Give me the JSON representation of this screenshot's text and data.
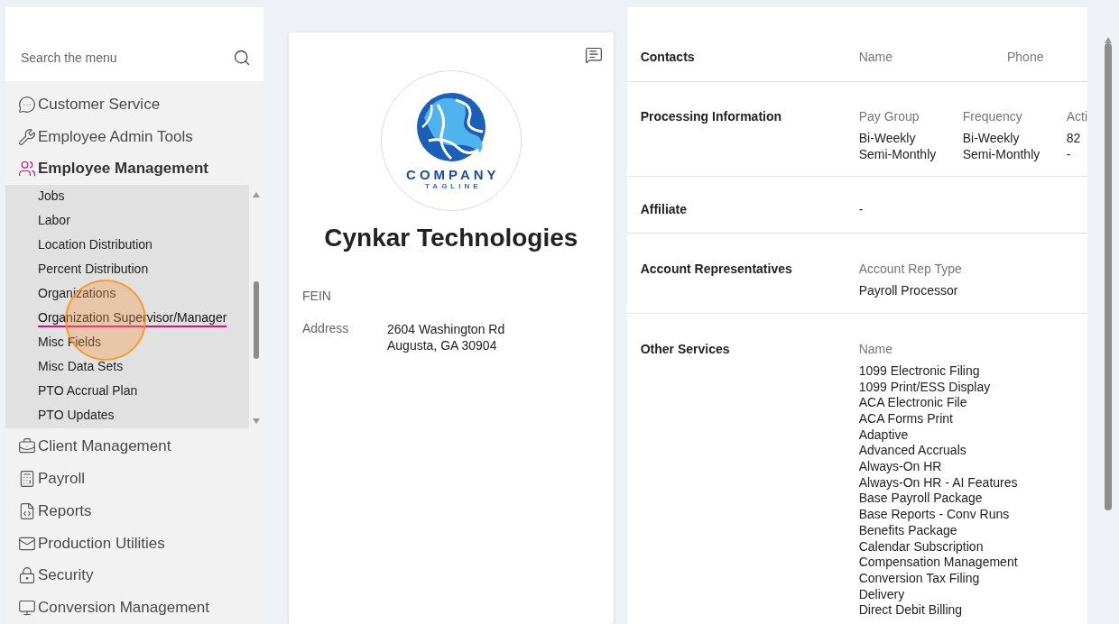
{
  "sidebar": {
    "search": {
      "placeholder": "Search the menu"
    },
    "menu_top": [
      {
        "label": "Customer Service",
        "selected": false
      },
      {
        "label": "Employee Admin Tools",
        "selected": false
      },
      {
        "label": "Employee Management",
        "selected": true
      }
    ],
    "submenu": [
      {
        "label": "Jobs",
        "selected": false
      },
      {
        "label": "Labor",
        "selected": false
      },
      {
        "label": "Location Distribution",
        "selected": false
      },
      {
        "label": "Percent Distribution",
        "selected": false
      },
      {
        "label": "Organizations",
        "selected": false
      },
      {
        "label": "Organization Supervisor/Manager",
        "selected": true
      },
      {
        "label": "Misc Fields",
        "selected": false
      },
      {
        "label": "Misc Data Sets",
        "selected": false
      },
      {
        "label": "PTO Accrual Plan",
        "selected": false
      },
      {
        "label": "PTO Updates",
        "selected": false
      }
    ],
    "menu_bottom": [
      {
        "label": "Client Management",
        "selected": false
      },
      {
        "label": "Payroll",
        "selected": false
      },
      {
        "label": "Reports",
        "selected": false
      },
      {
        "label": "Production Utilities",
        "selected": false
      },
      {
        "label": "Security",
        "selected": false
      },
      {
        "label": "Conversion Management",
        "selected": false
      }
    ]
  },
  "company": {
    "logo": {
      "wordmark": "COMPANY",
      "tagline": "TAGLINE"
    },
    "name": "Cynkar Technologies",
    "fields": [
      {
        "label": "FEIN"
      },
      {
        "label": "Address",
        "value": [
          "2604 Washington Rd",
          "Augusta, GA 30904"
        ]
      }
    ]
  },
  "details": [
    {
      "title": "Contacts",
      "kind": "split",
      "columns": [
        {
          "heading": "Name"
        },
        {
          "heading": "Phone"
        }
      ]
    },
    {
      "title": "Processing Information",
      "kind": "columns",
      "columns": [
        {
          "heading": "Pay Group",
          "values": [
            "Bi-Weekly",
            "Semi-Monthly"
          ]
        },
        {
          "heading": "Frequency",
          "values": [
            "Bi-Weekly",
            "Semi-Monthly"
          ]
        },
        {
          "heading": "Acti",
          "values": [
            "82",
            "-"
          ]
        }
      ]
    },
    {
      "title": "Affiliate",
      "kind": "value",
      "value": "-"
    },
    {
      "title": "Account Representatives",
      "kind": "columns",
      "columns": [
        {
          "heading": "Account Rep Type",
          "values": [
            "Payroll Processor"
          ]
        }
      ]
    },
    {
      "title": "Other Services",
      "kind": "columns",
      "columns": [
        {
          "heading": "Name",
          "values": [
            "1099 Electronic Filing",
            "1099 Print/ESS Display",
            "ACA Electronic File",
            "ACA Forms Print",
            "Adaptive",
            "Advanced Accruals",
            "Always-On HR",
            "Always-On HR - AI Features",
            "Base Payroll Package",
            "Base Reports - Conv Runs",
            "Benefits Package",
            "Calendar Subscription",
            "Compensation Management",
            "Conversion Tax Filing",
            "Delivery",
            "Direct Debit Billing"
          ]
        }
      ]
    }
  ]
}
